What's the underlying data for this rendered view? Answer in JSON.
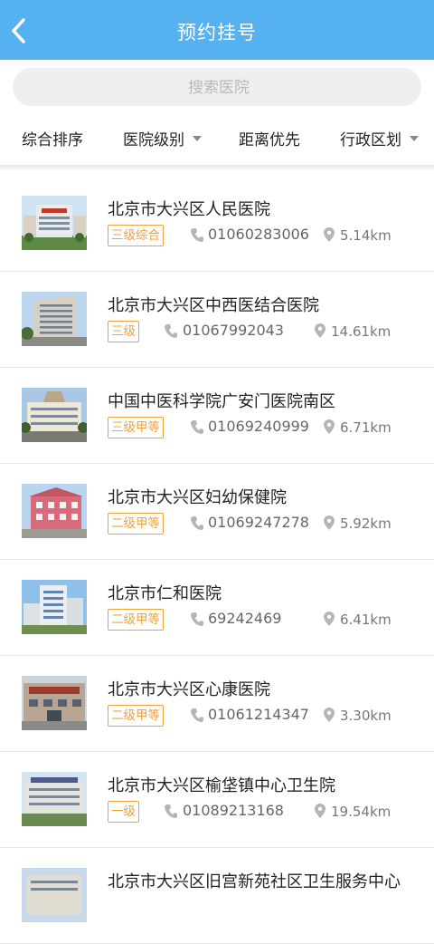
{
  "header": {
    "title": "预约挂号",
    "back_icon": "chevron-left-icon"
  },
  "search": {
    "placeholder": "搜索医院"
  },
  "filters": [
    {
      "label": "综合排序",
      "has_dropdown": false
    },
    {
      "label": "医院级别",
      "has_dropdown": true
    },
    {
      "label": "距离优先",
      "has_dropdown": false
    },
    {
      "label": "行政区划",
      "has_dropdown": true
    }
  ],
  "colors": {
    "header_bg": "#55b1ef",
    "level_badge": "#f0a23a"
  },
  "hospitals": [
    {
      "name": "北京市大兴区人民医院",
      "level": "三级综合",
      "phone": "01060283006",
      "distance": "5.14km"
    },
    {
      "name": "北京市大兴区中西医结合医院",
      "level": "三级",
      "phone": "01067992043",
      "distance": "14.61km"
    },
    {
      "name": "中国中医科学院广安门医院南区",
      "level": "三级甲等",
      "phone": "01069240999",
      "distance": "6.71km"
    },
    {
      "name": "北京市大兴区妇幼保健院",
      "level": "二级甲等",
      "phone": "01069247278",
      "distance": "5.92km"
    },
    {
      "name": "北京市仁和医院",
      "level": "二级甲等",
      "phone": "69242469",
      "distance": "6.41km"
    },
    {
      "name": "北京市大兴区心康医院",
      "level": "二级甲等",
      "phone": "01061214347",
      "distance": "3.30km"
    },
    {
      "name": "北京市大兴区榆垡镇中心卫生院",
      "level": "一级",
      "phone": "01089213168",
      "distance": "19.54km"
    },
    {
      "name": "北京市大兴区旧宫新苑社区卫生服务中心",
      "level": "",
      "phone": "",
      "distance": ""
    }
  ]
}
